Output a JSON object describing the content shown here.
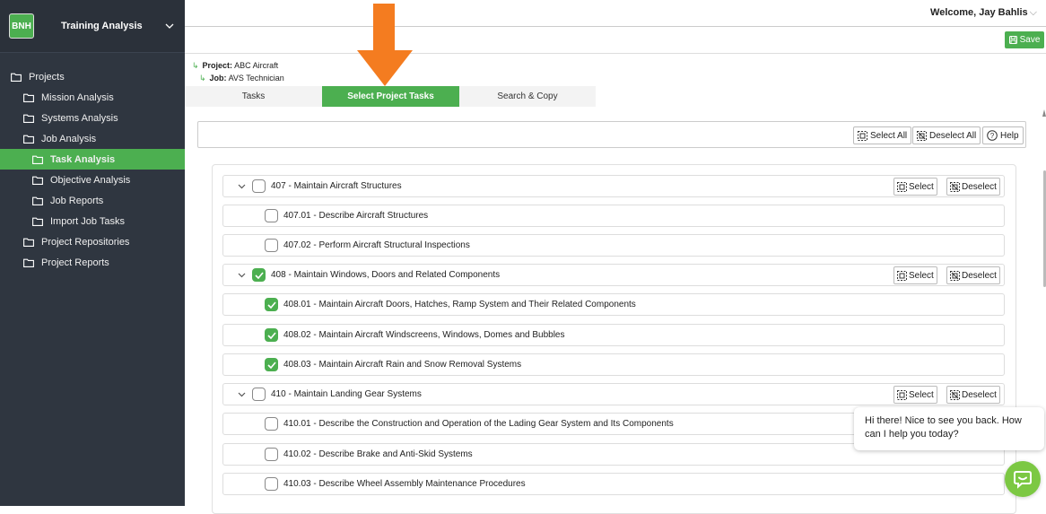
{
  "sidebar": {
    "logo": "BNH",
    "title": "Training Analysis",
    "items": [
      {
        "label": "Projects"
      },
      {
        "label": "Mission Analysis"
      },
      {
        "label": "Systems Analysis"
      },
      {
        "label": "Job Analysis"
      },
      {
        "label": "Task Analysis"
      },
      {
        "label": "Objective Analysis"
      },
      {
        "label": "Job Reports"
      },
      {
        "label": "Import Job Tasks"
      },
      {
        "label": "Project Repositories"
      },
      {
        "label": "Project Reports"
      }
    ]
  },
  "header": {
    "welcome": "Welcome, Jay Bahlis",
    "save_label": "Save"
  },
  "breadcrumb": {
    "project_label": "Project:",
    "project_value": "ABC Aircraft",
    "job_label": "Job:",
    "job_value": "AVS Technician"
  },
  "tabs": [
    {
      "label": "Tasks"
    },
    {
      "label": "Select Project Tasks"
    },
    {
      "label": "Search & Copy"
    }
  ],
  "toolbar": {
    "select_all": "Select All",
    "deselect_all": "Deselect All",
    "help": "Help"
  },
  "row_buttons": {
    "select": "Select",
    "deselect": "Deselect"
  },
  "tasks": [
    {
      "label": "407 - Maintain Aircraft Structures",
      "checked": false
    },
    {
      "label": "407.01 - Describe Aircraft Structures",
      "checked": false
    },
    {
      "label": "407.02 - Perform Aircraft Structural Inspections",
      "checked": false
    },
    {
      "label": "408 - Maintain Windows, Doors and Related Components",
      "checked": true
    },
    {
      "label": "408.01 - Maintain Aircraft Doors, Hatches, Ramp System and Their Related Components",
      "checked": true
    },
    {
      "label": "408.02 - Maintain Aircraft Windscreens, Windows, Domes and Bubbles",
      "checked": true
    },
    {
      "label": "408.03 - Maintain Aircraft Rain and Snow Removal Systems",
      "checked": true
    },
    {
      "label": "410 - Maintain Landing Gear Systems",
      "checked": false
    },
    {
      "label": "410.01 - Describe the Construction and Operation of the Lading Gear System and Its Components",
      "checked": false
    },
    {
      "label": "410.02 - Describe Brake and Anti-Skid Systems",
      "checked": false
    },
    {
      "label": "410.03 - Describe Wheel Assembly Maintenance Procedures",
      "checked": false
    }
  ],
  "chat": {
    "message": "Hi there! Nice to see you back. How can I help you today?"
  },
  "colors": {
    "accent": "#4caf50",
    "sidebar_bg": "#2f3640",
    "arrow": "#f47c20"
  }
}
